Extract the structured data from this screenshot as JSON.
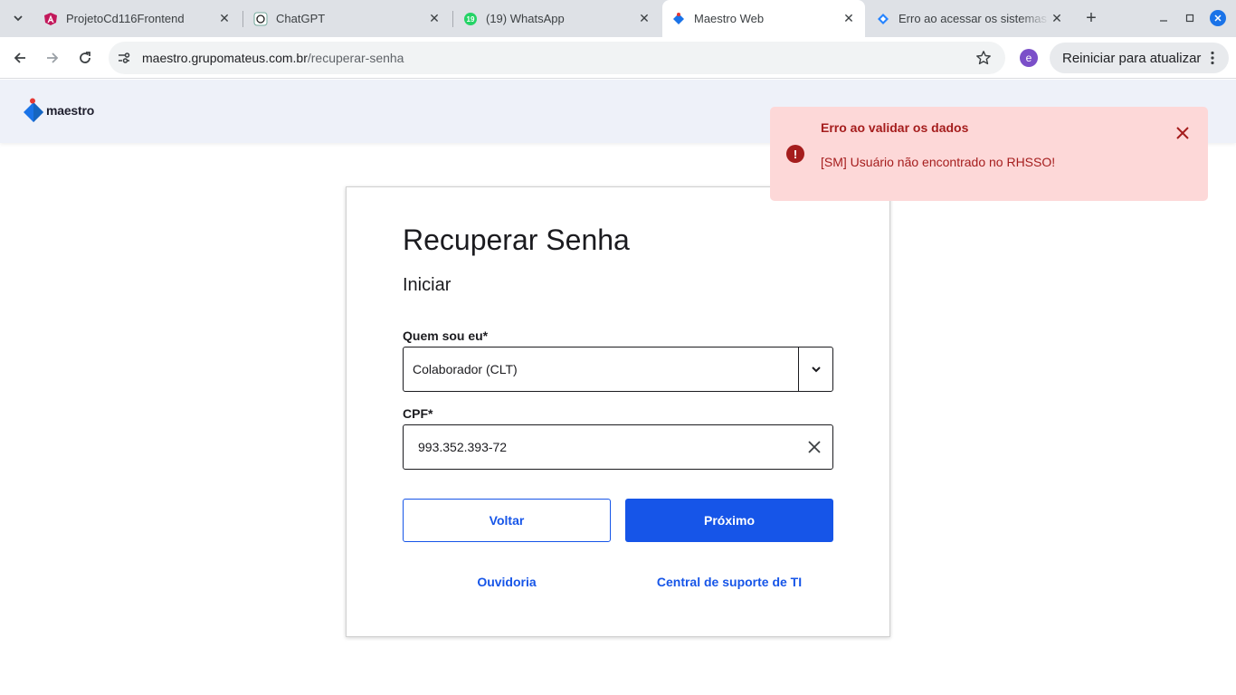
{
  "browser": {
    "tabs": [
      {
        "title": "ProjetoCd116Frontend",
        "icon": "angular-icon",
        "active": false
      },
      {
        "title": "ChatGPT",
        "icon": "chatgpt-icon",
        "active": false
      },
      {
        "title": "(19) WhatsApp",
        "icon": "whatsapp-icon",
        "badge": "19",
        "active": false
      },
      {
        "title": "Maestro Web",
        "icon": "maestro-icon",
        "active": true
      },
      {
        "title": "Erro ao acessar os sistemas",
        "icon": "jira-icon",
        "active": false
      }
    ],
    "url_host": "maestro.grupomateus.com.br",
    "url_path": "/recuperar-senha",
    "profile_initial": "e",
    "update_label": "Reiniciar para atualizar"
  },
  "header": {
    "logo_text": "maestro"
  },
  "form": {
    "title": "Recuperar Senha",
    "subtitle": "Iniciar",
    "role_label": "Quem sou eu*",
    "role_value": "Colaborador (CLT)",
    "cpf_label": "CPF*",
    "cpf_value": "993.352.393-72",
    "back_label": "Voltar",
    "next_label": "Próximo",
    "link_ombudsman": "Ouvidoria",
    "link_support": "Central de suporte de TI"
  },
  "toast": {
    "title": "Erro ao validar os dados",
    "message": "[SM] Usuário não encontrado no RHSSO!"
  },
  "colors": {
    "primary": "#1655e8",
    "error_bg": "#fdd8d8",
    "error_text": "#a51d1d",
    "header_bg": "#eef1f9"
  }
}
